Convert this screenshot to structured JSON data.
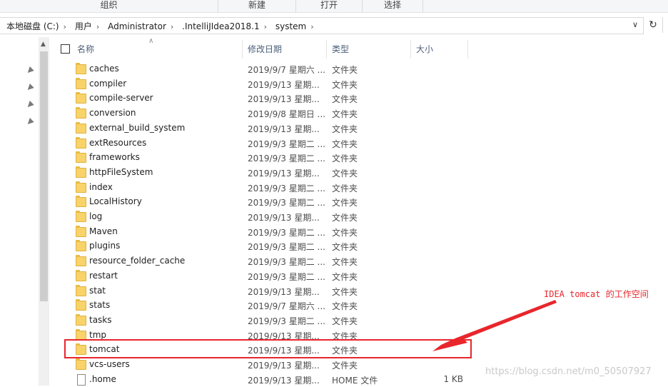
{
  "ribbon": {
    "groups": [
      "组织",
      "新建",
      "打开",
      "选择"
    ]
  },
  "address": {
    "crumbs": [
      "本地磁盘 (C:)",
      "用户",
      "Administrator",
      ".IntelliJIdea2018.1",
      "system"
    ],
    "dropdown_icon": "chevron-down-icon",
    "refresh_icon": "refresh-icon"
  },
  "columns": {
    "name": "名称",
    "date": "修改日期",
    "type": "类型",
    "size": "大小"
  },
  "files": [
    {
      "name": "caches",
      "date": "2019/9/7 星期六 ...",
      "type": "文件夹",
      "size": "",
      "kind": "folder"
    },
    {
      "name": "compiler",
      "date": "2019/9/13 星期...",
      "type": "文件夹",
      "size": "",
      "kind": "folder"
    },
    {
      "name": "compile-server",
      "date": "2019/9/13 星期...",
      "type": "文件夹",
      "size": "",
      "kind": "folder"
    },
    {
      "name": "conversion",
      "date": "2019/9/8 星期日 ...",
      "type": "文件夹",
      "size": "",
      "kind": "folder"
    },
    {
      "name": "external_build_system",
      "date": "2019/9/13 星期...",
      "type": "文件夹",
      "size": "",
      "kind": "folder"
    },
    {
      "name": "extResources",
      "date": "2019/9/3 星期二 ...",
      "type": "文件夹",
      "size": "",
      "kind": "folder"
    },
    {
      "name": "frameworks",
      "date": "2019/9/3 星期二 ...",
      "type": "文件夹",
      "size": "",
      "kind": "folder"
    },
    {
      "name": "httpFileSystem",
      "date": "2019/9/13 星期...",
      "type": "文件夹",
      "size": "",
      "kind": "folder"
    },
    {
      "name": "index",
      "date": "2019/9/3 星期二 ...",
      "type": "文件夹",
      "size": "",
      "kind": "folder"
    },
    {
      "name": "LocalHistory",
      "date": "2019/9/3 星期二 ...",
      "type": "文件夹",
      "size": "",
      "kind": "folder"
    },
    {
      "name": "log",
      "date": "2019/9/13 星期...",
      "type": "文件夹",
      "size": "",
      "kind": "folder"
    },
    {
      "name": "Maven",
      "date": "2019/9/3 星期二 ...",
      "type": "文件夹",
      "size": "",
      "kind": "folder"
    },
    {
      "name": "plugins",
      "date": "2019/9/3 星期二 ...",
      "type": "文件夹",
      "size": "",
      "kind": "folder"
    },
    {
      "name": "resource_folder_cache",
      "date": "2019/9/3 星期二 ...",
      "type": "文件夹",
      "size": "",
      "kind": "folder"
    },
    {
      "name": "restart",
      "date": "2019/9/3 星期二 ...",
      "type": "文件夹",
      "size": "",
      "kind": "folder"
    },
    {
      "name": "stat",
      "date": "2019/9/13 星期...",
      "type": "文件夹",
      "size": "",
      "kind": "folder"
    },
    {
      "name": "stats",
      "date": "2019/9/7 星期六 ...",
      "type": "文件夹",
      "size": "",
      "kind": "folder"
    },
    {
      "name": "tasks",
      "date": "2019/9/3 星期二 ...",
      "type": "文件夹",
      "size": "",
      "kind": "folder"
    },
    {
      "name": "tmp",
      "date": "2019/9/13 星期...",
      "type": "文件夹",
      "size": "",
      "kind": "folder"
    },
    {
      "name": "tomcat",
      "date": "2019/9/13 星期...",
      "type": "文件夹",
      "size": "",
      "kind": "folder"
    },
    {
      "name": "vcs-users",
      "date": "2019/9/13 星期...",
      "type": "文件夹",
      "size": "",
      "kind": "folder"
    },
    {
      "name": ".home",
      "date": "2019/9/13 星期...",
      "type": "HOME 文件",
      "size": "1 KB",
      "kind": "file"
    }
  ],
  "annotation": {
    "text": "IDEA tomcat 的工作空间",
    "color": "#e8262c"
  },
  "watermark": "https://blog.csdn.net/m0_50507927"
}
